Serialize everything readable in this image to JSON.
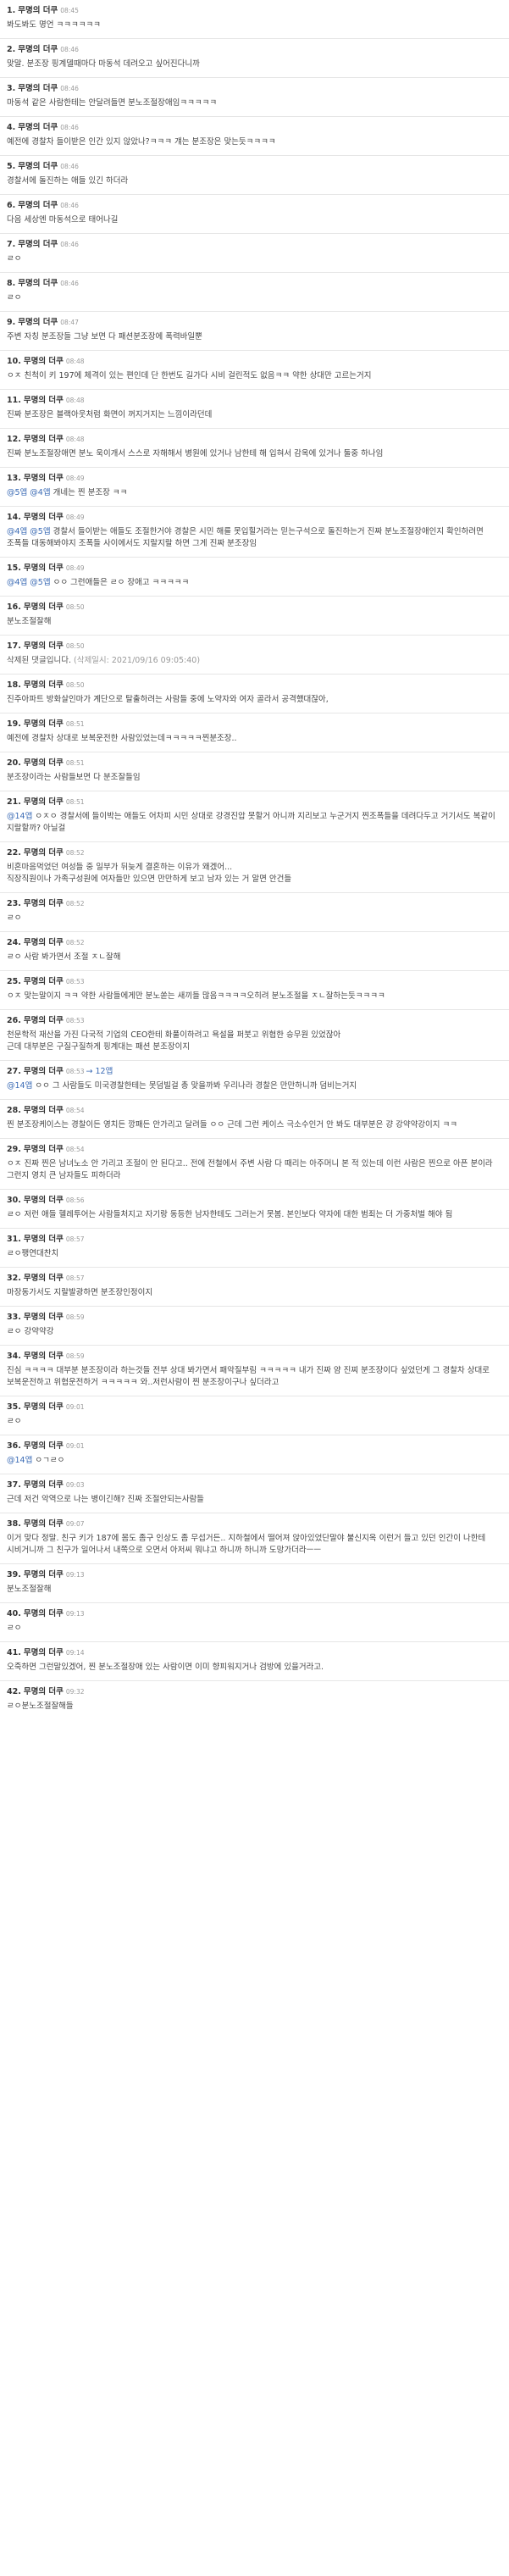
{
  "comments": [
    {
      "num": "1.",
      "author": "무명의 더쿠",
      "time": "08:45",
      "body": "봐도봐도 명언 ㅋㅋㅋㅋㅋㅋ"
    },
    {
      "num": "2.",
      "author": "무명의 더쿠",
      "time": "08:46",
      "body": "맞말. 분조장 핑계델때마다 마동석 데려오고 싶어진다니까"
    },
    {
      "num": "3.",
      "author": "무명의 더쿠",
      "time": "08:46",
      "body": "마동석 같은 사람한테는 안달려들면 분노조절장애임ㅋㅋㅋㅋㅋ"
    },
    {
      "num": "4.",
      "author": "무명의 더쿠",
      "time": "08:46",
      "body": "예전에 경찰차 들이받은 인간 있지 않았나?ㅋㅋㅋ 걔는 분조장은 맞는듯ㅋㅋㅋㅋ"
    },
    {
      "num": "5.",
      "author": "무명의 더쿠",
      "time": "08:46",
      "body": "경찰서에 돌진하는 애들 있긴 하더라"
    },
    {
      "num": "6.",
      "author": "무명의 더쿠",
      "time": "08:46",
      "body": "다음 세상엔 마동석으로 태어나길"
    },
    {
      "num": "7.",
      "author": "무명의 더쿠",
      "time": "08:46",
      "body": "ㄹㅇ"
    },
    {
      "num": "8.",
      "author": "무명의 더쿠",
      "time": "08:46",
      "body": "ㄹㅇ"
    },
    {
      "num": "9.",
      "author": "무명의 더쿠",
      "time": "08:47",
      "body": "주변 자칭 분조장들 그냥 보면 다 패션분조장에 폭력바일뿐"
    },
    {
      "num": "10.",
      "author": "무명의 더쿠",
      "time": "08:48",
      "body": "ㅇㅈ 친척이 키 197에 체격이 있는 편인데 단 한번도 길가다 시비 걸린적도 없음ㅋㅋ 약한 상대만 고르는거지"
    },
    {
      "num": "11.",
      "author": "무명의 더쿠",
      "time": "08:48",
      "body": "진짜 분조장은 블랙아웃처럼 화면이 꺼지거지는 느낌이라던데"
    },
    {
      "num": "12.",
      "author": "무명의 더쿠",
      "time": "08:48",
      "body": "진짜 분노조절장애면 분노 욱이개서 스스로 자해해서 병원에 있거나 남한테 해 입혀서 감옥에 있거나 둘중 하나임"
    },
    {
      "num": "13.",
      "author": "무명의 더쿠",
      "time": "08:49",
      "mention": "@5앱 @4앱",
      "body": "개네는 찐 분조장 ㅋㅋ"
    },
    {
      "num": "14.",
      "author": "무명의 더쿠",
      "time": "08:49",
      "mention": "@4앱 @5앱",
      "body": "경찰서 들이받는 애들도 조절한거야 경찰은 시민 해를 못입힐거라는 믿는구석으로 돌진하는거 진짜 분노조절장애인지 확인하려면 조폭들 대동해봐야지 조폭들 사이에서도 지랄지랄 하면 그게 진짜 분조장임"
    },
    {
      "num": "15.",
      "author": "무명의 더쿠",
      "time": "08:49",
      "mention": "@4앱 @5앱",
      "body": "ㅇㅇ 그런애들은 ㄹㅇ 장애고 ㅋㅋㅋㅋㅋ"
    },
    {
      "num": "16.",
      "author": "무명의 더쿠",
      "time": "08:50",
      "body": "분노조절잘해"
    },
    {
      "num": "17.",
      "author": "무명의 더쿠",
      "time": "08:50",
      "deleted": "삭제된 댓글입니다.",
      "deleted_time": "(삭제일시: 2021/09/16 09:05:40)"
    },
    {
      "num": "18.",
      "author": "무명의 더쿠",
      "time": "08:50",
      "body": "진주아파트 방화살인마가 계단으로 탈출하려는 사람들 중에 노약자와 여자 골라서 공격했대잖아,"
    },
    {
      "num": "19.",
      "author": "무명의 더쿠",
      "time": "08:51",
      "body": "예전에 경찰차 상대로 보복운전한 사람있었는데ㅋㅋㅋㅋㅋ찐분조장.."
    },
    {
      "num": "20.",
      "author": "무명의 더쿠",
      "time": "08:51",
      "body": "분조장이라는 사람들보면 다 분조잘들임"
    },
    {
      "num": "21.",
      "author": "무명의 더쿠",
      "time": "08:51",
      "mention": "@14앱",
      "body": "ㅇㅈㅇ 경찰서에 들이박는 애들도 어차피 시민 상대로 강경진압 못할거 아니까 지리보고 누군거지 찐조폭들을 데려다두고 거기서도 복같이 지랄할까? 아닐걸"
    },
    {
      "num": "22.",
      "author": "무명의 더쿠",
      "time": "08:52",
      "body": "비혼마음먹었던 여성들 중 일부가 뒤늦게 결혼하는 이유가 왜겠어...\n직장직원이나 가족구성원에 여자들만 있으면 만만하게 보고 남자 있는 거 알면 안건들"
    },
    {
      "num": "23.",
      "author": "무명의 더쿠",
      "time": "08:52",
      "body": "ㄹㅇ"
    },
    {
      "num": "24.",
      "author": "무명의 더쿠",
      "time": "08:52",
      "body": "ㄹㅇ 사람 봐가면서 조절 ㅈㄴ잘해"
    },
    {
      "num": "25.",
      "author": "무명의 더쿠",
      "time": "08:53",
      "body": "ㅇㅈ 맞는말이지 ㅋㅋ 약한 사람들에게만 분노쏟는 새끼들 많음ㅋㅋㅋㅋ오히려 분노조절을 ㅈㄴ잘하는듯ㅋㅋㅋㅋ"
    },
    {
      "num": "26.",
      "author": "무명의 더쿠",
      "time": "08:53",
      "body": "천문학적 재산을 가진 다국적 기업의 CEO한테 화풀이하려고 욕설을 퍼붓고 위협한 승무원 있었잖아\n근데 대부분은 구질구질하게 핑계대는 패션 분조장이지"
    },
    {
      "num": "27.",
      "author": "무명의 더쿠",
      "time": "08:53",
      "ref": "→ 12앱",
      "mention": "@14앱",
      "body": "ㅇㅇ 그 사람들도 미국경찰한테는 못덤빌걸 총 맞을까봐 우리나라 경찰은 만만하니까 덤비는거지"
    },
    {
      "num": "28.",
      "author": "무명의 더쿠",
      "time": "08:54",
      "body": "찐 분조장케이스는 경찰이든 영치든 깡패든 안가리고 달려들 ㅇㅇ 근데 그런 케이스 극소수인거 안 봐도 대부분은 걍 강약약강이지 ㅋㅋ"
    },
    {
      "num": "29.",
      "author": "무명의 더쿠",
      "time": "08:54",
      "body": "ㅇㅈ 진짜 찐은 남녀노소 안 가리고 조절이 안 된다고.. 전에 전철에서 주변 사람 다 때리는 아주머니 본 적 있는데 이런 사람은 찐으로 아픈 분이라 그런지 영치 큰 남자들도 피하더라"
    },
    {
      "num": "30.",
      "author": "무명의 더쿠",
      "time": "08:56",
      "body": "ㄹㅇ 저런 애들 헬레투어는 사람들처지고 자기랑 동등한 남자한테도 그러는거 못봄. 본인보다 약자에 대한 범죄는 더 가중처벌 해야 됨"
    },
    {
      "num": "31.",
      "author": "무명의 더쿠",
      "time": "08:57",
      "body": "ㄹㅇ팽연대찬치"
    },
    {
      "num": "32.",
      "author": "무명의 더쿠",
      "time": "08:57",
      "body": "마장동가서도 지랄발광하면 분조장인정이지"
    },
    {
      "num": "33.",
      "author": "무명의 더쿠",
      "time": "08:59",
      "body": "ㄹㅇ 강약약강"
    },
    {
      "num": "34.",
      "author": "무명의 더쿠",
      "time": "08:59",
      "body": "진심 ㅋㅋㅋㅋ 대부분 분조장이라 하는것들 전부 상대 봐가면서 패악질부림 ㅋㅋㅋㅋㅋ 내가 진짜 얌 진찌 분조장이다 싶었던게 그 경찰차 상대로 보복운전하고 위협운전하거 ㅋㅋㅋㅋㅋ 와..저런사람이 찐 분조장이구나 싶더라고"
    },
    {
      "num": "35.",
      "author": "무명의 더쿠",
      "time": "09:01",
      "body": "ㄹㅇ"
    },
    {
      "num": "36.",
      "author": "무명의 더쿠",
      "time": "09:01",
      "mention": "@14앱",
      "body": "ㅇㄱㄹㅇ"
    },
    {
      "num": "37.",
      "author": "무명의 더쿠",
      "time": "09:03",
      "body": "근데 저건 악역으로 나는 병이긴해? 진짜 조절안되는사람들"
    },
    {
      "num": "38.",
      "author": "무명의 더쿠",
      "time": "09:07",
      "body": "이거 맞다 정말. 친구 키가 187에 몸도 좀구 인상도 좀 무섭거든.. 지하철에서 떨어져 앉아있었단말야 불신지옥 이런거 들고 있던 인간이 나한테 시비거니까 그 친구가 일어나서 내쪽으로 오면서 아저씨 뭐냐고 하니까 하니까 도망가더라ㅡㅡ"
    },
    {
      "num": "39.",
      "author": "무명의 더쿠",
      "time": "09:13",
      "body": "분노조절잘해"
    },
    {
      "num": "40.",
      "author": "무명의 더쿠",
      "time": "09:13",
      "body": "ㄹㅇ"
    },
    {
      "num": "41.",
      "author": "무명의 더쿠",
      "time": "09:14",
      "body": "오죽하면 그런말있겠어, 찐 분노조절장애 있는 사람이면 이미 향피워지거나 검방에 있을거라고."
    },
    {
      "num": "42.",
      "author": "무명의 더쿠",
      "time": "09:32",
      "body": "ㄹㅇ분노조절잘해들"
    }
  ],
  "colors": {
    "mention": "#3b6bb5",
    "time": "#999999",
    "divider": "#e6e6e6"
  }
}
